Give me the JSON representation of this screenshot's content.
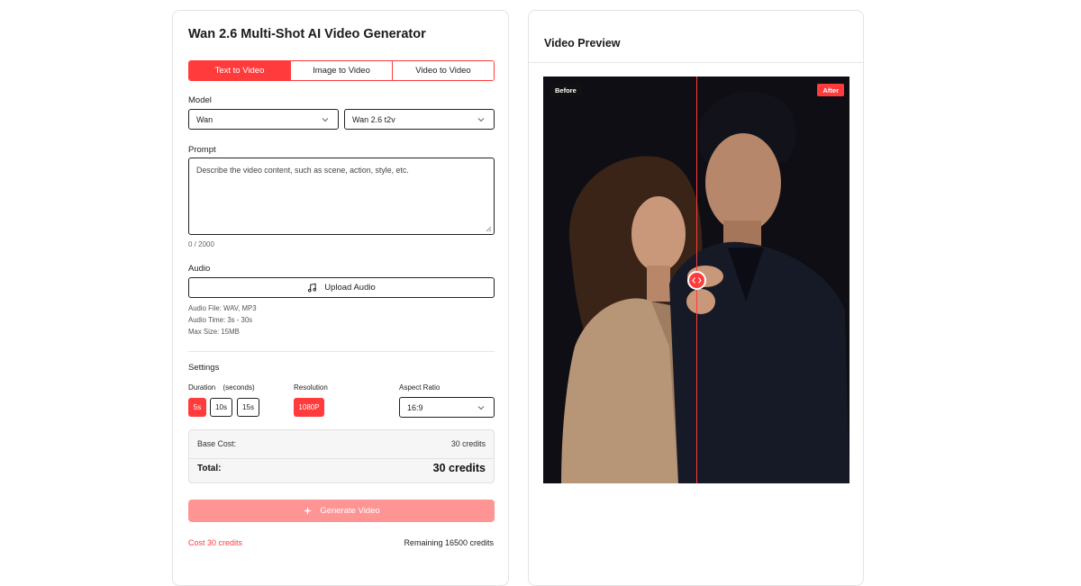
{
  "generator": {
    "title": "Wan 2.6 Multi-Shot AI Video Generator",
    "tabs": [
      {
        "label": "Text to Video",
        "active": true
      },
      {
        "label": "Image to Video",
        "active": false
      },
      {
        "label": "Video to Video",
        "active": false
      }
    ],
    "model": {
      "label": "Model",
      "provider_value": "Wan",
      "version_value": "Wan 2.6 t2v"
    },
    "prompt": {
      "label": "Prompt",
      "placeholder": "Describe the video content, such as scene, action, style, etc.",
      "value": "",
      "counter": "0 / 2000"
    },
    "audio": {
      "label": "Audio",
      "upload_label": "Upload Audio",
      "file_hint": "Audio File: WAV, MP3",
      "time_hint": "Audio Time: 3s - 30s",
      "size_hint": "Max Size: 15MB"
    },
    "settings": {
      "label": "Settings",
      "duration_label": "Duration",
      "duration_unit": "(seconds)",
      "durations": [
        {
          "label": "5s",
          "selected": true
        },
        {
          "label": "10s",
          "selected": false
        },
        {
          "label": "15s",
          "selected": false
        }
      ],
      "resolution_label": "Resolution",
      "resolution_value": "1080P",
      "aspect_label": "Aspect Ratio",
      "aspect_value": "16:9"
    },
    "cost": {
      "base_label": "Base Cost:",
      "base_value": "30 credits",
      "total_label": "Total:",
      "total_value": "30 credits"
    },
    "generate_label": "Generate Video",
    "footer_cost": "Cost 30 credits",
    "footer_remaining": "Remaining 16500 credits"
  },
  "preview": {
    "title": "Video Preview",
    "before_label": "Before",
    "after_label": "After"
  },
  "colors": {
    "accent": "#ff3b3b",
    "accent_disabled": "#ff9494"
  },
  "icons": {
    "select_arrow": "chevron-down-icon",
    "upload": "music-note-icon",
    "generate": "sparkle-icon",
    "compare_handle": "compare-arrows-icon"
  }
}
